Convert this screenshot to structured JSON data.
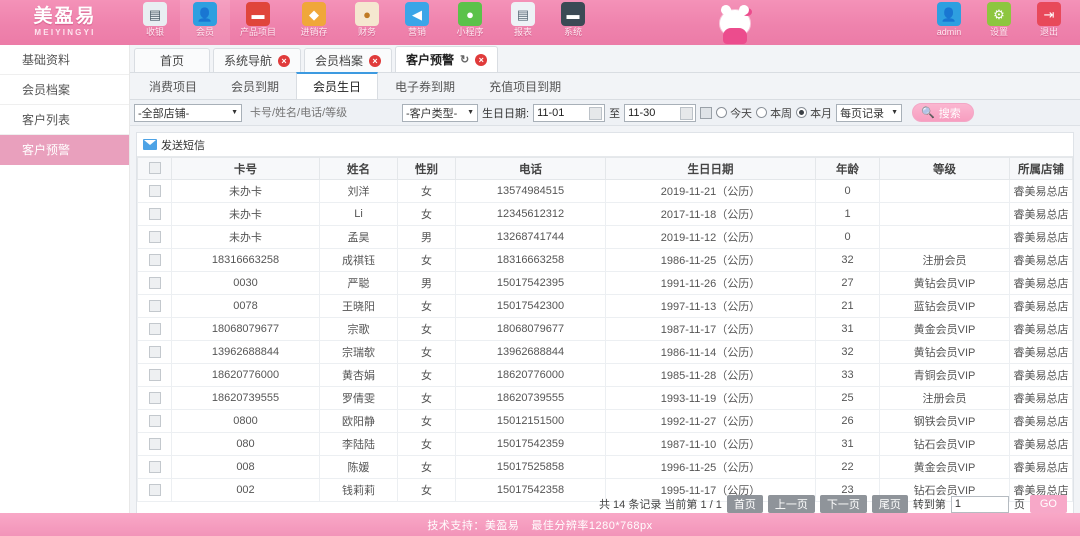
{
  "brand": {
    "logo_main": "美盈易",
    "logo_sub": "MEIYINGYI"
  },
  "topnav": {
    "items": [
      {
        "label": "收银",
        "icon": "cash-register-icon",
        "active": false
      },
      {
        "label": "会员",
        "icon": "user-circle-icon",
        "active": true
      },
      {
        "label": "产品项目",
        "icon": "inbox-icon",
        "active": false
      },
      {
        "label": "进销存",
        "icon": "money-stack-icon",
        "active": false
      },
      {
        "label": "财务",
        "icon": "coins-icon",
        "active": false
      },
      {
        "label": "营销",
        "icon": "megaphone-icon",
        "active": false
      },
      {
        "label": "小程序",
        "icon": "wechat-icon",
        "active": false
      },
      {
        "label": "报表",
        "icon": "clipboard-icon",
        "active": false
      },
      {
        "label": "系统",
        "icon": "monitor-icon",
        "active": false
      }
    ],
    "right": [
      {
        "label": "admin",
        "icon": "account-icon"
      },
      {
        "label": "设置",
        "icon": "gear-icon"
      },
      {
        "label": "退出",
        "icon": "logout-icon"
      }
    ]
  },
  "sidebar": {
    "items": [
      {
        "label": "基础资料",
        "active": false
      },
      {
        "label": "会员档案",
        "active": false
      },
      {
        "label": "客户列表",
        "active": false
      },
      {
        "label": "客户预警",
        "active": true
      }
    ]
  },
  "tabs": [
    {
      "label": "首页",
      "closable": false,
      "refresh": false,
      "active": false
    },
    {
      "label": "系统导航",
      "closable": true,
      "refresh": false,
      "active": false
    },
    {
      "label": "会员档案",
      "closable": true,
      "refresh": false,
      "active": false
    },
    {
      "label": "客户预警",
      "closable": true,
      "refresh": true,
      "active": true
    }
  ],
  "subtabs": [
    {
      "label": "消费项目",
      "active": false
    },
    {
      "label": "会员到期",
      "active": false
    },
    {
      "label": "会员生日",
      "active": true
    },
    {
      "label": "电子券到期",
      "active": false
    },
    {
      "label": "充值项目到期",
      "active": false
    }
  ],
  "filters": {
    "shop_select": "-全部店铺-",
    "keyword_placeholder": "卡号/姓名/电话/等级",
    "keyword_value": "",
    "type_select": "-客户类型-",
    "date_label": "生日日期:",
    "date_from": "11-01",
    "date_to_label": "至",
    "date_to": "11-30",
    "radio_today": "今天",
    "radio_week": "本周",
    "radio_month": "本月",
    "radio_selected": "本月",
    "page_size_select": "每页记录",
    "search_button": "搜索",
    "search_icon": "magnifier-icon"
  },
  "toolbar": {
    "sms_button": "发送短信",
    "sms_icon": "envelope-icon"
  },
  "table": {
    "columns": [
      "",
      "卡号",
      "姓名",
      "性别",
      "电话",
      "生日日期",
      "年龄",
      "等级",
      "所属店铺"
    ],
    "rows": [
      {
        "card": "未办卡",
        "name": "刘洋",
        "sex": "女",
        "phone": "13574984515",
        "birthday": "2019-11-21（公历）",
        "age": "0",
        "level": "",
        "shop": "睿美易总店"
      },
      {
        "card": "未办卡",
        "name": "Li",
        "sex": "女",
        "phone": "12345612312",
        "birthday": "2017-11-18（公历）",
        "age": "1",
        "level": "",
        "shop": "睿美易总店"
      },
      {
        "card": "未办卡",
        "name": "孟昊",
        "sex": "男",
        "phone": "13268741744",
        "birthday": "2019-11-12（公历）",
        "age": "0",
        "level": "",
        "shop": "睿美易总店"
      },
      {
        "card": "18316663258",
        "name": "成祺钰",
        "sex": "女",
        "phone": "18316663258",
        "birthday": "1986-11-25（公历）",
        "age": "32",
        "level": "注册会员",
        "shop": "睿美易总店"
      },
      {
        "card": "0030",
        "name": "严聪",
        "sex": "男",
        "phone": "15017542395",
        "birthday": "1991-11-26（公历）",
        "age": "27",
        "level": "黄钻会员VIP",
        "shop": "睿美易总店"
      },
      {
        "card": "0078",
        "name": "王晓阳",
        "sex": "女",
        "phone": "15017542300",
        "birthday": "1997-11-13（公历）",
        "age": "21",
        "level": "蓝钻会员VIP",
        "shop": "睿美易总店"
      },
      {
        "card": "18068079677",
        "name": "宗歌",
        "sex": "女",
        "phone": "18068079677",
        "birthday": "1987-11-17（公历）",
        "age": "31",
        "level": "黄金会员VIP",
        "shop": "睿美易总店"
      },
      {
        "card": "13962688844",
        "name": "宗瑞欹",
        "sex": "女",
        "phone": "13962688844",
        "birthday": "1986-11-14（公历）",
        "age": "32",
        "level": "黄钻会员VIP",
        "shop": "睿美易总店"
      },
      {
        "card": "18620776000",
        "name": "黄杏娟",
        "sex": "女",
        "phone": "18620776000",
        "birthday": "1985-11-28（公历）",
        "age": "33",
        "level": "青铜会员VIP",
        "shop": "睿美易总店"
      },
      {
        "card": "18620739555",
        "name": "罗倩雯",
        "sex": "女",
        "phone": "18620739555",
        "birthday": "1993-11-19（公历）",
        "age": "25",
        "level": "注册会员",
        "shop": "睿美易总店"
      },
      {
        "card": "0800",
        "name": "欧阳静",
        "sex": "女",
        "phone": "15012151500",
        "birthday": "1992-11-27（公历）",
        "age": "26",
        "level": "钢铁会员VIP",
        "shop": "睿美易总店"
      },
      {
        "card": "080",
        "name": "李陆陆",
        "sex": "女",
        "phone": "15017542359",
        "birthday": "1987-11-10（公历）",
        "age": "31",
        "level": "钻石会员VIP",
        "shop": "睿美易总店"
      },
      {
        "card": "008",
        "name": "陈媛",
        "sex": "女",
        "phone": "15017525858",
        "birthday": "1996-11-25（公历）",
        "age": "22",
        "level": "黄金会员VIP",
        "shop": "睿美易总店"
      },
      {
        "card": "002",
        "name": "钱莉莉",
        "sex": "女",
        "phone": "15017542358",
        "birthday": "1995-11-17（公历）",
        "age": "23",
        "level": "钻石会员VIP",
        "shop": "睿美易总店"
      }
    ]
  },
  "pagination": {
    "summary": "共 14 条记录 当前第 1 / 1",
    "first": "首页",
    "prev": "上一页",
    "next": "下一页",
    "last": "尾页",
    "jump_label": "转到第",
    "jump_value": "1",
    "page_unit": "页",
    "go": "GO"
  },
  "footer": {
    "support": "技术支持：美盈易",
    "resolution": "最佳分辨率1280*768px"
  },
  "colors": {
    "brand_pink": "#ef83ad",
    "active_tab_blue": "#3d9ae0",
    "sidebar_active": "#e9a0bd"
  }
}
